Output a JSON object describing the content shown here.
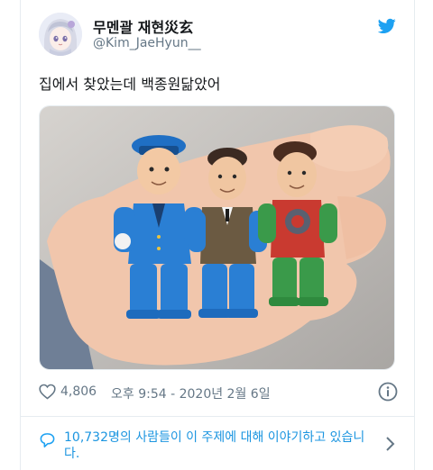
{
  "tweet": {
    "display_name": "무멘괄 재현災玄",
    "handle": "@Kim_JaeHyun__",
    "text": "집에서 찾았는데 백종원닮았어",
    "likes": "4,806",
    "timestamp": "오후 9:54 - 2020년 2월 6일",
    "conversation": "10,732명의 사람들이 이 주제에 대해 이야기하고 있습니다."
  },
  "icons": {
    "brand": "twitter-bird-icon",
    "like": "heart-icon",
    "info": "info-icon",
    "conversation": "speech-bubble-icon",
    "more": "chevron-right-icon"
  },
  "colors": {
    "twitter_blue": "#1da1f2",
    "link_blue": "#1b95e0",
    "secondary_text": "#657786",
    "primary_text": "#14171a",
    "border": "#e6ecf0"
  }
}
